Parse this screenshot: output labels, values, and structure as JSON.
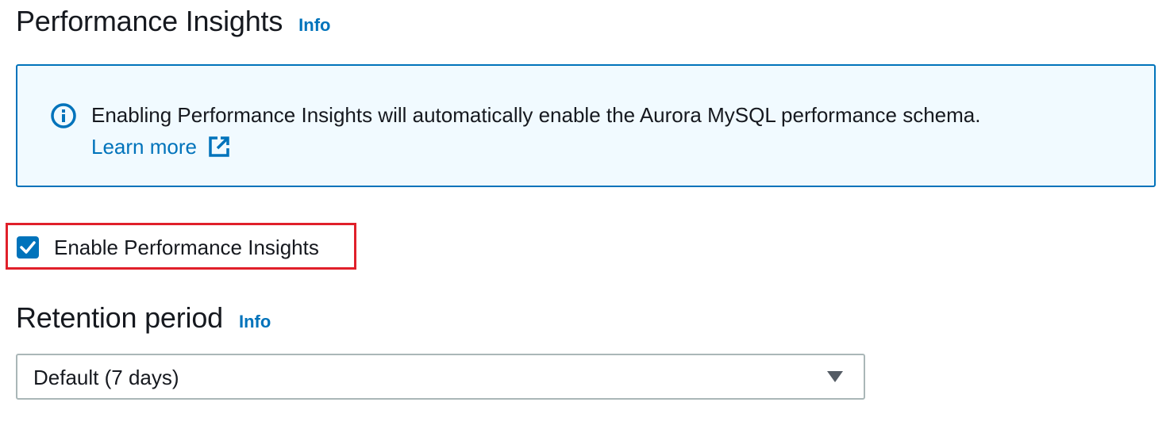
{
  "performance_insights": {
    "title": "Performance Insights",
    "info_label": "Info",
    "alert": {
      "icon": "info-circle-icon",
      "message": "Enabling Performance Insights will automatically enable the Aurora MySQL performance schema.",
      "learn_more_label": "Learn more",
      "learn_more_icon": "external-link-icon"
    },
    "enable_checkbox": {
      "label": "Enable Performance Insights",
      "checked": true
    }
  },
  "retention_period": {
    "title": "Retention period",
    "info_label": "Info",
    "selected_value": "Default (7 days)"
  },
  "colors": {
    "accent": "#0073bb",
    "alert_background": "#f1faff",
    "highlight": "#e0202a",
    "text": "#16191f"
  }
}
